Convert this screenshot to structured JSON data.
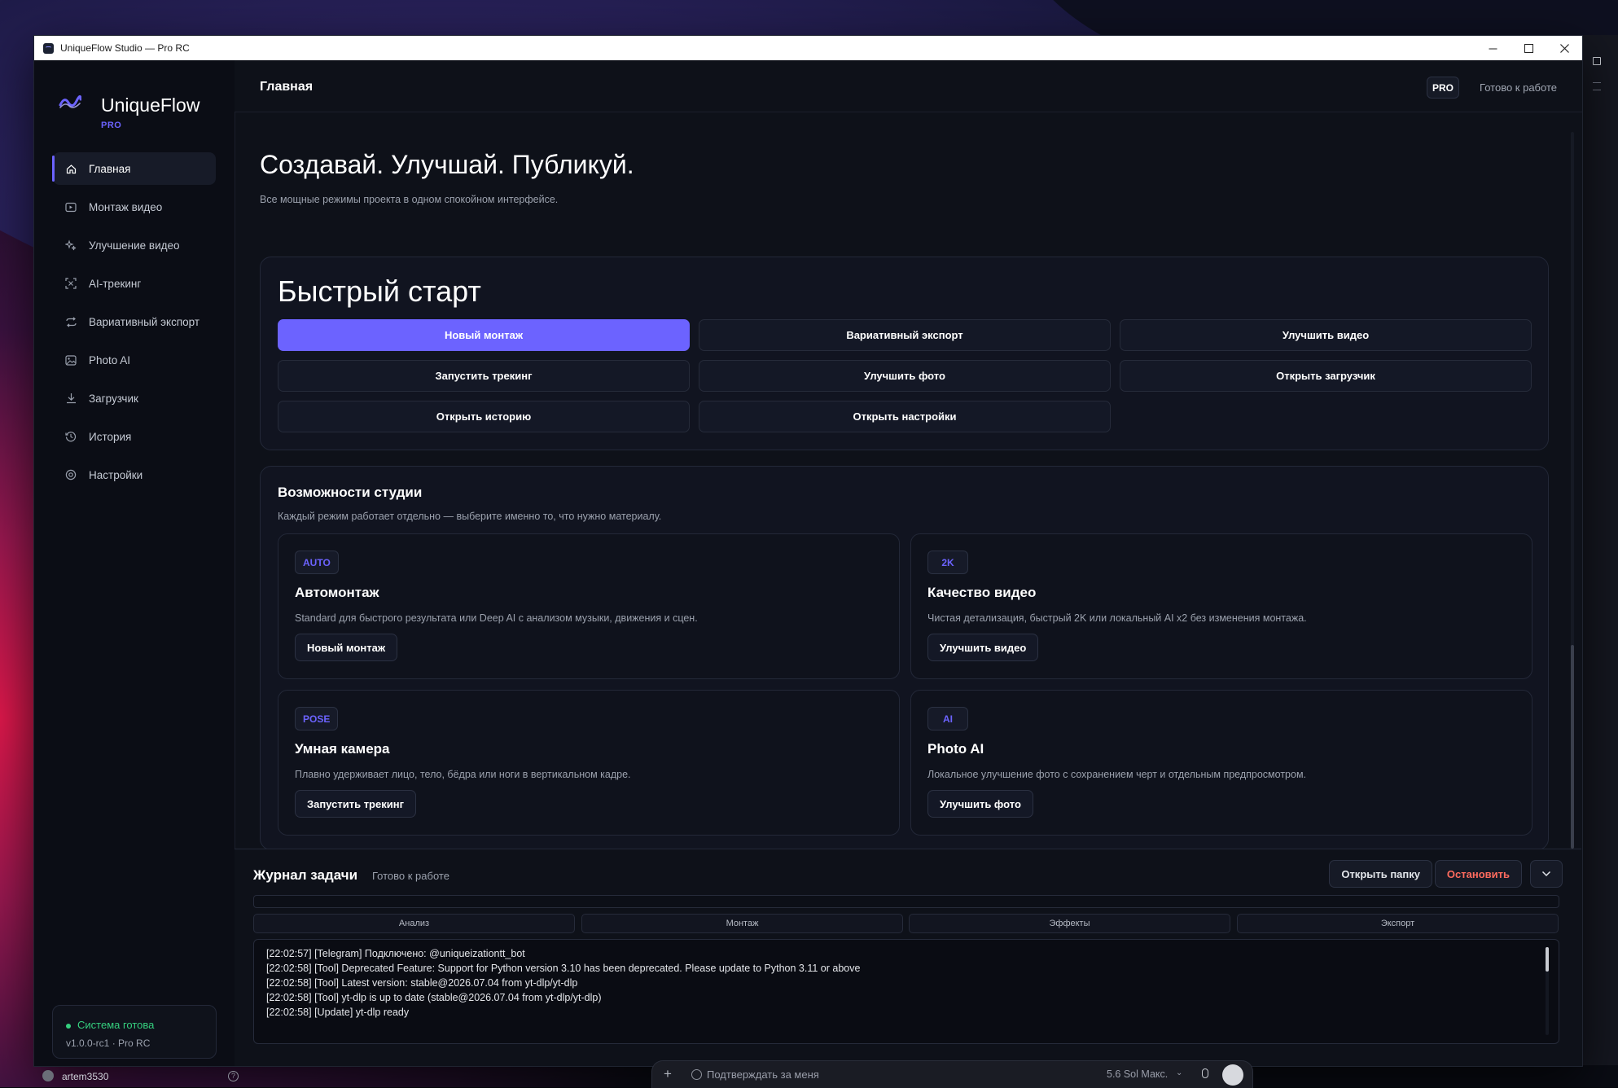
{
  "window": {
    "title": "UniqueFlow Studio — Pro RC",
    "controls": {
      "minimize": "minimize-icon",
      "maximize": "maximize-icon",
      "close": "close-icon"
    }
  },
  "sidebar": {
    "brand_name": "UniqueFlow",
    "brand_tag": "PRO",
    "items": [
      {
        "label": "Главная",
        "icon": "home-icon",
        "active": true
      },
      {
        "label": "Монтаж видео",
        "icon": "video-play-icon",
        "active": false
      },
      {
        "label": "Улучшение видео",
        "icon": "sparkles-icon",
        "active": false
      },
      {
        "label": "AI-трекинг",
        "icon": "tracking-icon",
        "active": false
      },
      {
        "label": "Вариативный экспорт",
        "icon": "repeat-icon",
        "active": false
      },
      {
        "label": "Photo AI",
        "icon": "image-icon",
        "active": false
      },
      {
        "label": "Загрузчик",
        "icon": "download-icon",
        "active": false
      },
      {
        "label": "История",
        "icon": "history-icon",
        "active": false
      },
      {
        "label": "Настройки",
        "icon": "settings-icon",
        "active": false
      }
    ],
    "status": {
      "text": "Система готова",
      "version": "v1.0.0-rc1 · Pro RC"
    }
  },
  "topbar": {
    "title": "Главная",
    "badge": "PRO",
    "status": "Готово к работе"
  },
  "hero": {
    "title": "Создавай. Улучшай. Публикуй.",
    "subtitle": "Все мощные режимы проекта в одном спокойном интерфейсе."
  },
  "quick_start": {
    "title": "Быстрый старт",
    "buttons": [
      "Новый монтаж",
      "Вариативный экспорт",
      "Улучшить видео",
      "Запустить трекинг",
      "Улучшить фото",
      "Открыть загрузчик",
      "Открыть историю",
      "Открыть настройки"
    ]
  },
  "features": {
    "title": "Возможности студии",
    "subtitle": "Каждый режим работает отдельно — выберите именно то, что нужно материалу.",
    "cards": [
      {
        "badge": "AUTO",
        "title": "Автомонтаж",
        "desc": "Standard для быстрого результата или Deep AI с анализом музыки, движения и сцен.",
        "button": "Новый монтаж"
      },
      {
        "badge": "2K",
        "title": "Качество видео",
        "desc": "Чистая детализация, быстрый 2K или локальный AI x2 без изменения монтажа.",
        "button": "Улучшить видео"
      },
      {
        "badge": "POSE",
        "title": "Умная камера",
        "desc": "Плавно удерживает лицо, тело, бёдра или ноги в вертикальном кадре.",
        "button": "Запустить трекинг"
      },
      {
        "badge": "AI",
        "title": "Photo AI",
        "desc": "Локальное улучшение фото с сохранением черт и отдельным предпросмотром.",
        "button": "Улучшить фото"
      }
    ]
  },
  "log": {
    "title": "Журнал задачи",
    "status": "Готово к работе",
    "open_folder": "Открыть папку",
    "stop": "Остановить",
    "collapse_icon": "chevron-down-icon",
    "progress": 0,
    "stages": [
      "Анализ",
      "Монтаж",
      "Эффекты",
      "Экспорт"
    ],
    "lines": [
      "[22:02:57] [Telegram] Подключено: @uniqueizationtt_bot",
      "[22:02:58] [Tool] Deprecated Feature: Support for Python version 3.10 has been deprecated. Please update to Python 3.11 or above",
      "[22:02:58] [Tool] Latest version: stable@2026.07.04 from yt-dlp/yt-dlp",
      "[22:02:58] [Tool] yt-dlp is up to date (stable@2026.07.04 from yt-dlp/yt-dlp)",
      "[22:02:58] [Update] yt-dlp ready"
    ]
  },
  "taskbar": {
    "username": "artem3530",
    "chat_placeholder": "Подтверждать за меня",
    "model": "5.6 Sol Макс."
  },
  "colors": {
    "accent": "#6c63ff",
    "success": "#35d07f",
    "danger": "#ff6b5e",
    "background": "#0e1119"
  }
}
